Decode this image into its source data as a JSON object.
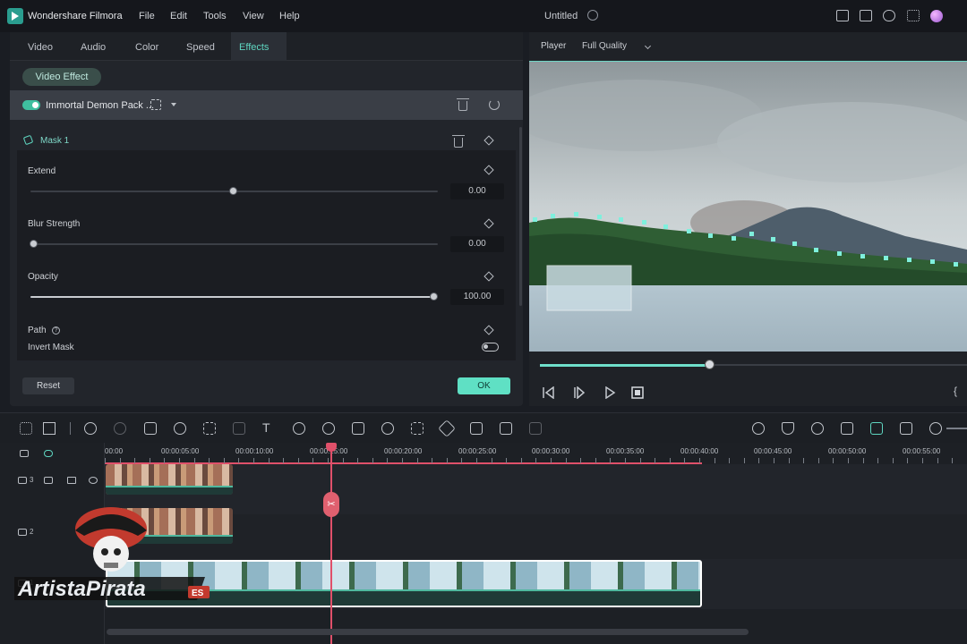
{
  "app": {
    "name": "Wondershare Filmora",
    "menu": [
      "File",
      "Edit",
      "Tools",
      "View",
      "Help"
    ],
    "document_title": "Untitled"
  },
  "tabs": [
    "Video",
    "Audio",
    "Color",
    "Speed",
    "Effects"
  ],
  "active_tab": "Effects",
  "effects_panel": {
    "section_pill": "Video Effect",
    "effect_name": "Immortal Demon Pack ...",
    "mask_title": "Mask 1",
    "params": [
      {
        "label": "Extend",
        "value": "0.00",
        "level": 0.5
      },
      {
        "label": "Blur Strength",
        "value": "0.00",
        "level": 0.0
      },
      {
        "label": "Opacity",
        "value": "100.00",
        "level": 1.0
      }
    ],
    "path_label": "Path",
    "invert_mask_label": "Invert Mask",
    "invert_mask_on": false,
    "reset_button": "Reset",
    "ok_button": "OK"
  },
  "player": {
    "label": "Player",
    "quality": "Full Quality",
    "progress": 0.4
  },
  "timeline": {
    "ruler_labels": [
      "00:00",
      "00:00:05:00",
      "00:00:10:00",
      "00:00:15:00",
      "00:00:20:00",
      "00:00:25:00",
      "00:00:30:00",
      "00:00:35:00",
      "00:00:40:00",
      "00:00:45:00",
      "00:00:50:00",
      "00:00:55:00"
    ],
    "track_numbers": [
      "3",
      "2",
      "1"
    ]
  },
  "watermark": {
    "text": "ArtistaPirata",
    "suffix": "ES"
  },
  "colors": {
    "accent": "#5fd6c1",
    "ok_button": "#5fe0c4",
    "playhead": "#e0506a"
  }
}
